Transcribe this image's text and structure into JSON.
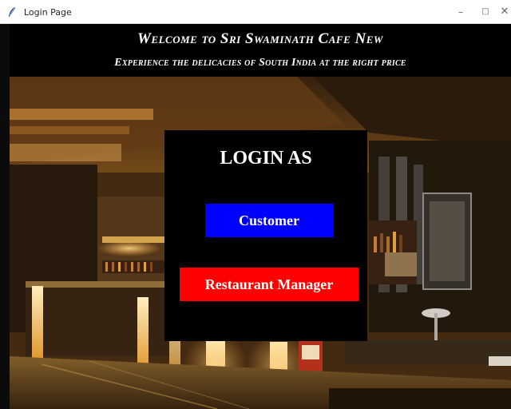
{
  "window": {
    "title": "Login Page",
    "minimize": "–",
    "maximize": "□",
    "close": "✕"
  },
  "header": {
    "welcome": "Welcome to Sri Swaminath Cafe New",
    "tagline": "Experience the delicacies of South India at the right price"
  },
  "login": {
    "title": "LOGIN AS",
    "customer_label": "Customer",
    "manager_label": "Restaurant Manager"
  },
  "colors": {
    "customer_button": "#0000ff",
    "manager_button": "#ff0000",
    "panel": "#000000",
    "header_bg": "#000000"
  },
  "icons": {
    "app": "feather-icon",
    "scene": "restaurant-interior-background"
  }
}
